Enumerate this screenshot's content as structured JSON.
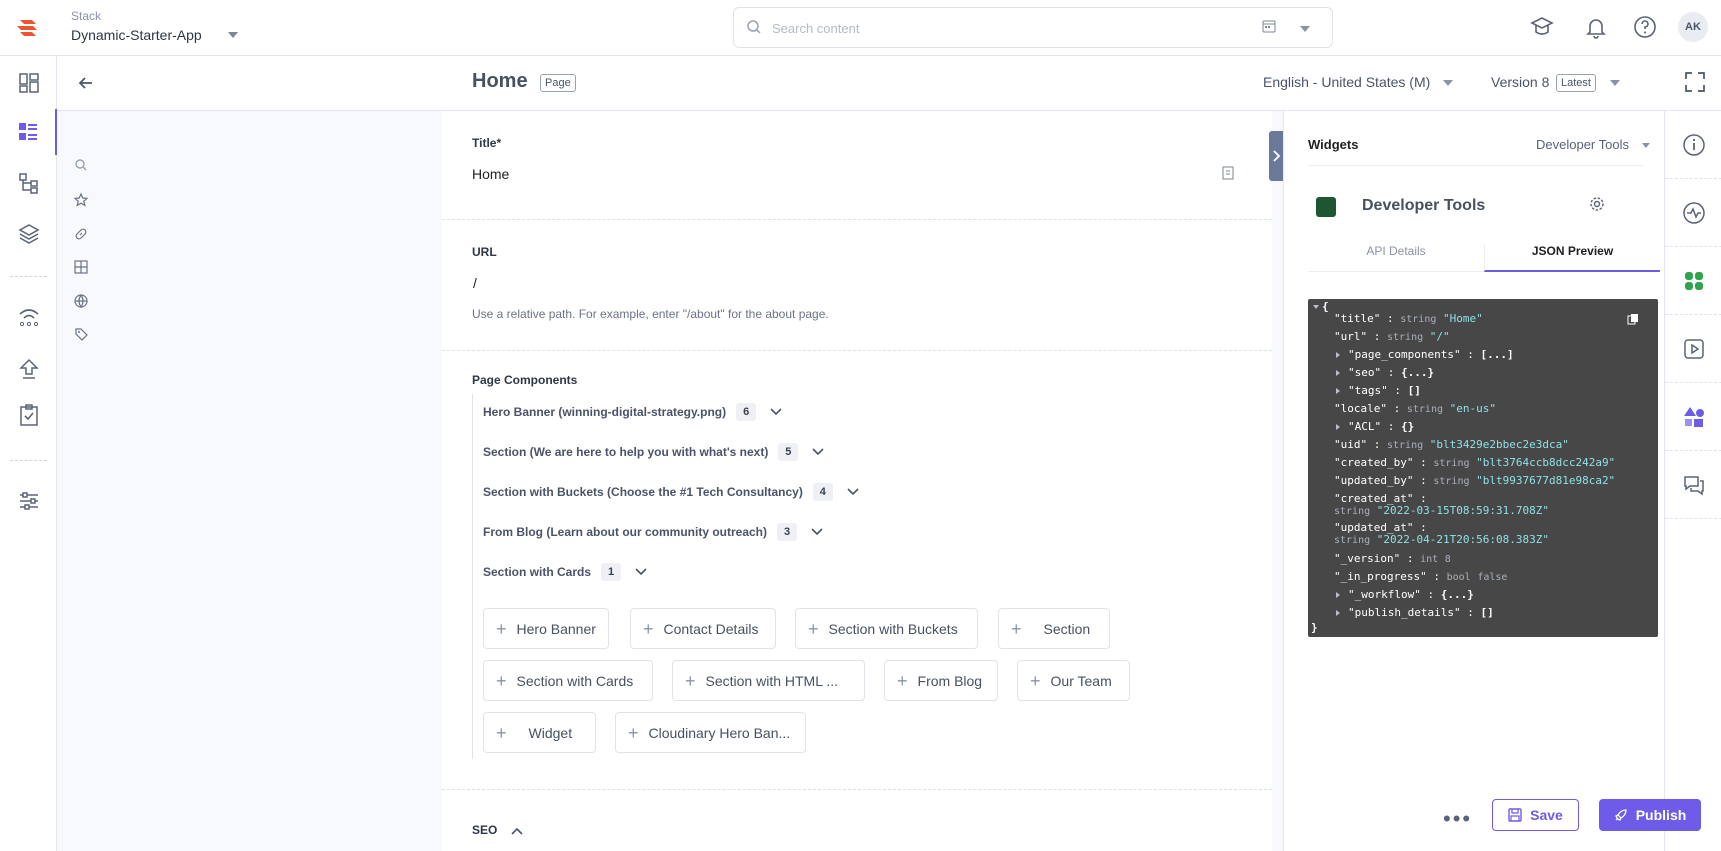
{
  "topbar": {
    "stack_label": "Stack",
    "stack_name": "Dynamic-Starter-App",
    "search_placeholder": "Search content",
    "avatar_initials": "AK"
  },
  "subheader": {
    "page_title": "Home",
    "page_badge": "Page",
    "locale": "English - United States (M)",
    "version": "Version 8",
    "version_badge": "Latest"
  },
  "editor": {
    "title_label": "Title*",
    "title_value": "Home",
    "url_label": "URL",
    "url_value": "/",
    "url_help": "Use a relative path. For example, enter \"/about\" for the about page.",
    "components_label": "Page Components",
    "components": [
      {
        "label": "Hero Banner (winning-digital-strategy.png)",
        "count": "6"
      },
      {
        "label": "Section (We are here to help you with what's next)",
        "count": "5"
      },
      {
        "label": "Section with Buckets (Choose the #1 Tech Consultancy)",
        "count": "4"
      },
      {
        "label": "From Blog (Learn about our community outreach)",
        "count": "3"
      },
      {
        "label": "Section with Cards",
        "count": "1"
      }
    ],
    "add_buttons": [
      "Hero Banner",
      "Contact Details",
      "Section with Buckets",
      "Section",
      "Section with Cards",
      "Section with HTML ...",
      "From Blog",
      "Our Team",
      "Widget",
      "Cloudinary Hero Ban..."
    ],
    "seo_label": "SEO"
  },
  "widgets": {
    "title": "Widgets",
    "selected": "Developer Tools",
    "tool_title": "Developer Tools",
    "tabs": [
      "API Details",
      "JSON Preview"
    ],
    "json": {
      "open": "{",
      "close": "}",
      "title_k": "\"title\"",
      "title_t": "string",
      "title_v": "\"Home\"",
      "url_k": "\"url\"",
      "url_t": "string",
      "url_v": "\"/\"",
      "pc_k": "\"page_components\"",
      "pc_v": "[...]",
      "seo_k": "\"seo\"",
      "seo_v": "{...}",
      "tags_k": "\"tags\"",
      "tags_v": "[]",
      "locale_k": "\"locale\"",
      "locale_t": "string",
      "locale_v": "\"en-us\"",
      "acl_k": "\"ACL\"",
      "acl_v": "{}",
      "uid_k": "\"uid\"",
      "uid_t": "string",
      "uid_v": "\"blt3429e2bbec2e3dca\"",
      "cb_k": "\"created_by\"",
      "cb_t": "string",
      "cb_v": "\"blt3764ccb8dcc242a9\"",
      "ub_k": "\"updated_by\"",
      "ub_t": "string",
      "ub_v": "\"blt9937677d81e98ca2\"",
      "ca_k": "\"created_at\"",
      "ca_t": "string",
      "ca_v": "\"2022-03-15T08:59:31.708Z\"",
      "ua_k": "\"updated_at\"",
      "ua_t": "string",
      "ua_v": "\"2022-04-21T20:56:08.383Z\"",
      "ver_k": "\"_version\"",
      "ver_t": "int",
      "ver_v": "8",
      "ip_k": "\"_in_progress\"",
      "ip_t": "bool",
      "ip_v": "false",
      "wf_k": "\"_workflow\"",
      "wf_v": "{...}",
      "pd_k": "\"publish_details\"",
      "pd_v": "[]",
      "colon": ":"
    }
  },
  "footer": {
    "more": "•••",
    "save": "Save",
    "publish": "Publish"
  },
  "colors": {
    "accent": "#6c5ce7",
    "json_bg": "#474747",
    "json_value": "#8fe0e6"
  }
}
